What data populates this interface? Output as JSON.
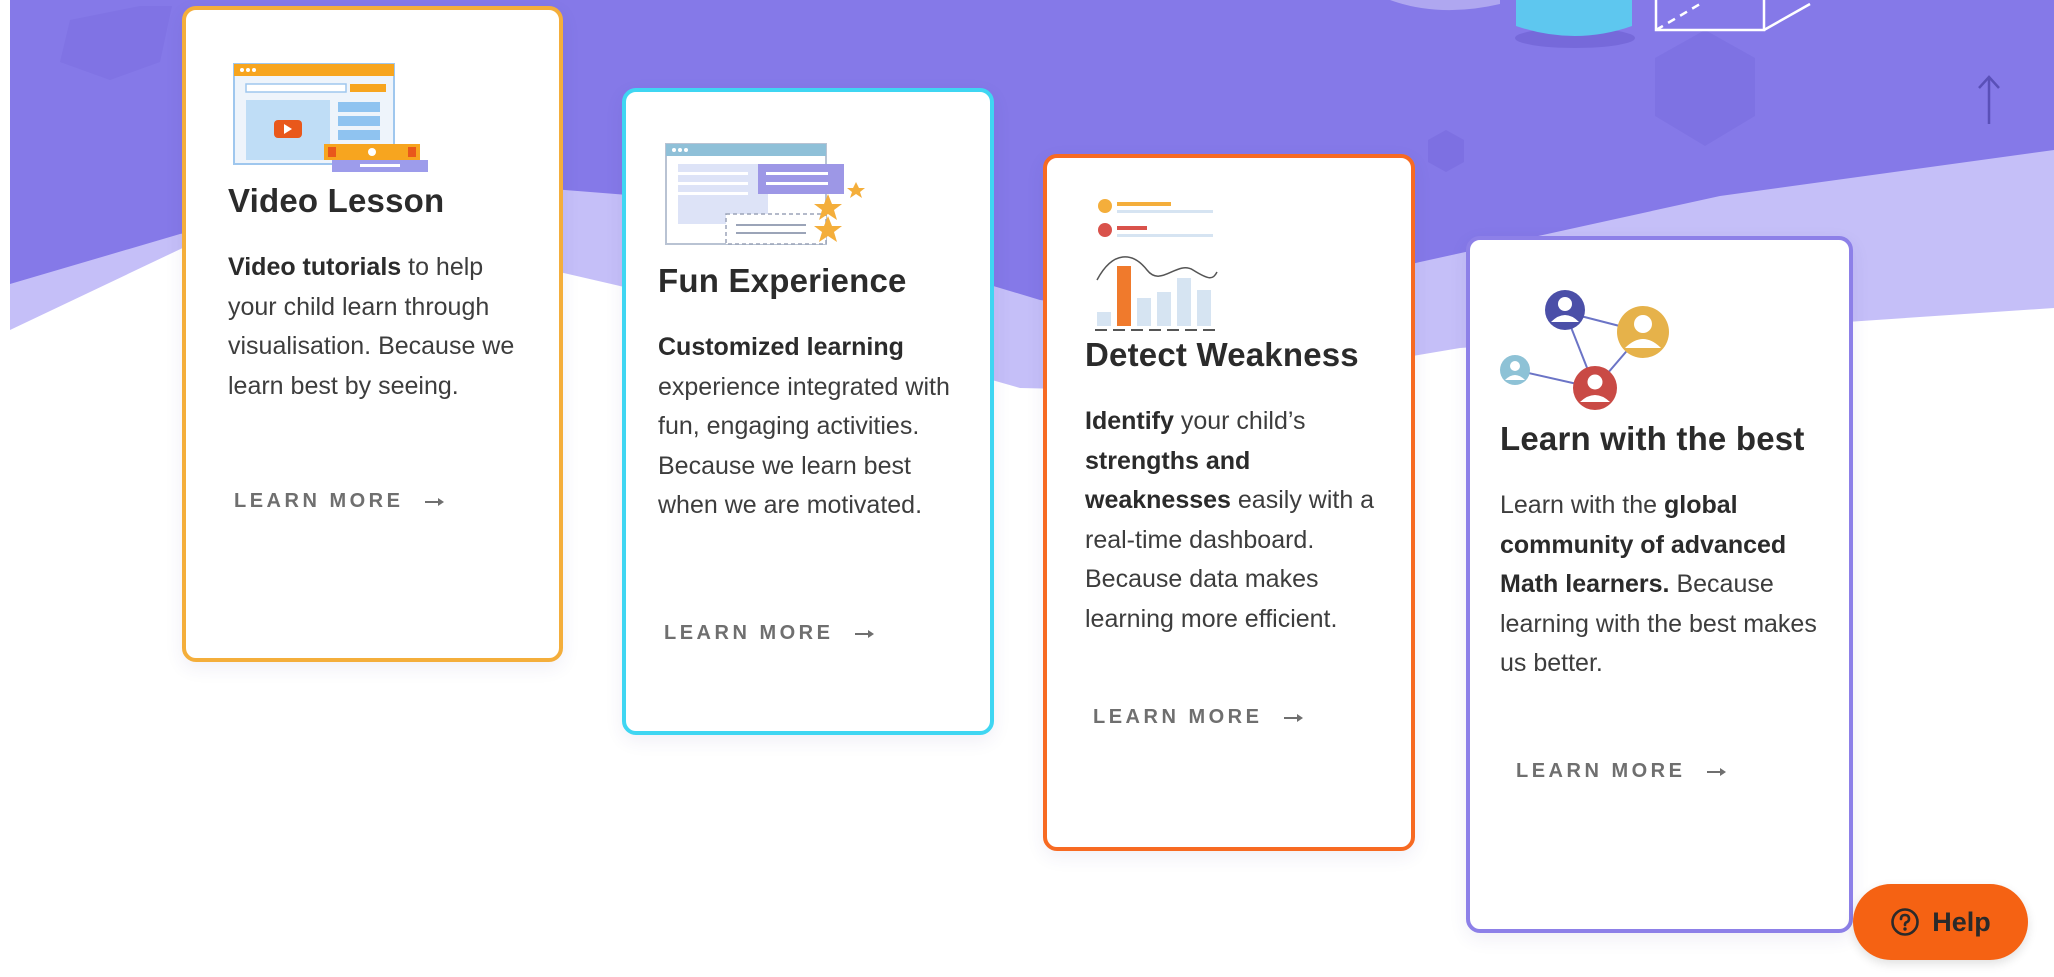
{
  "cards": [
    {
      "title": "Video Lesson",
      "text_bold_1": "Video tutorials",
      "text_1": " to help your child learn through visualisation. Because we learn best by seeing.",
      "learn_more": "LEARN MORE",
      "border_color": "#F4AE3B",
      "icon": "video-lesson-illustration"
    },
    {
      "title": "Fun Experience",
      "text_bold_1": "Customized learning",
      "text_1": " experience integrated with fun, engaging activities. Because we learn best when we are motivated.",
      "learn_more": "LEARN MORE",
      "border_color": "#3FD6F2",
      "icon": "fun-experience-illustration"
    },
    {
      "title": "Detect Weakness",
      "text_bold_1": "Identify",
      "text_1": " your child’s ",
      "text_bold_2": "strengths and weaknesses",
      "text_2": " easily with a real-time dashboard. Because data makes learning more efficient.",
      "learn_more": "LEARN MORE",
      "border_color": "#F76A22",
      "icon": "dashboard-illustration"
    },
    {
      "title": "Learn with the best",
      "text_1": "Learn with the ",
      "text_bold_1": "global community of advanced Math learners.",
      "text_2": " Because learning with the best makes us better.",
      "learn_more": "LEARN MORE",
      "border_color": "#8D80E8",
      "icon": "community-network-illustration"
    }
  ],
  "help": {
    "label": "Help",
    "icon": "question-circle-icon",
    "color": "#F56213"
  },
  "scroll_top": {
    "icon": "arrow-up-icon"
  },
  "colors": {
    "hero_purple": "#8579E8",
    "hero_lavender": "#C5BFF8"
  }
}
